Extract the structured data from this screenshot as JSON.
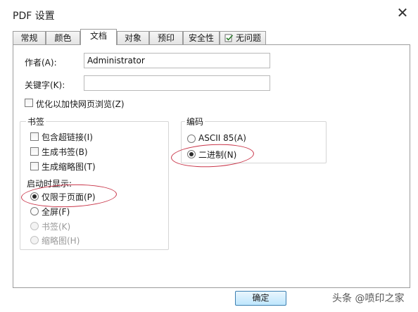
{
  "dialog": {
    "title": "PDF 设置",
    "close_glyph": "✕"
  },
  "tabs": [
    {
      "label": "常规"
    },
    {
      "label": "颜色"
    },
    {
      "label": "文档",
      "active": true
    },
    {
      "label": "对象"
    },
    {
      "label": "预印"
    },
    {
      "label": "安全性"
    },
    {
      "label": "无问题",
      "icon": "check-document-icon"
    }
  ],
  "fields": {
    "author_label": "作者(A):",
    "author_value": "Administrator",
    "keywords_label": "关键字(K):",
    "keywords_value": ""
  },
  "optimize": {
    "label": "优化以加快网页浏览(Z)",
    "checked": false
  },
  "bookmarks": {
    "title": "书签",
    "options": [
      {
        "label": "包含超链接(I)",
        "checked": false
      },
      {
        "label": "生成书签(B)",
        "checked": false
      },
      {
        "label": "生成缩略图(T)",
        "checked": false
      }
    ],
    "startup_label": "启动时显示:",
    "startup_options": [
      {
        "label": "仅限于页面(P)",
        "checked": true,
        "enabled": true
      },
      {
        "label": "全屏(F)",
        "checked": false,
        "enabled": true
      },
      {
        "label": "书签(K)",
        "checked": false,
        "enabled": false
      },
      {
        "label": "缩略图(H)",
        "checked": false,
        "enabled": false
      }
    ]
  },
  "encoding": {
    "title": "编码",
    "options": [
      {
        "label": "ASCII 85(A)",
        "checked": false
      },
      {
        "label": "二进制(N)",
        "checked": true
      }
    ]
  },
  "buttons": {
    "ok_label": "确定"
  },
  "watermark": {
    "text": "头条 @喷印之家"
  },
  "colors": {
    "highlight_ellipse": "#c9364a",
    "ok_border": "#3c7fb1",
    "tab_border": "#9c9c9c"
  }
}
